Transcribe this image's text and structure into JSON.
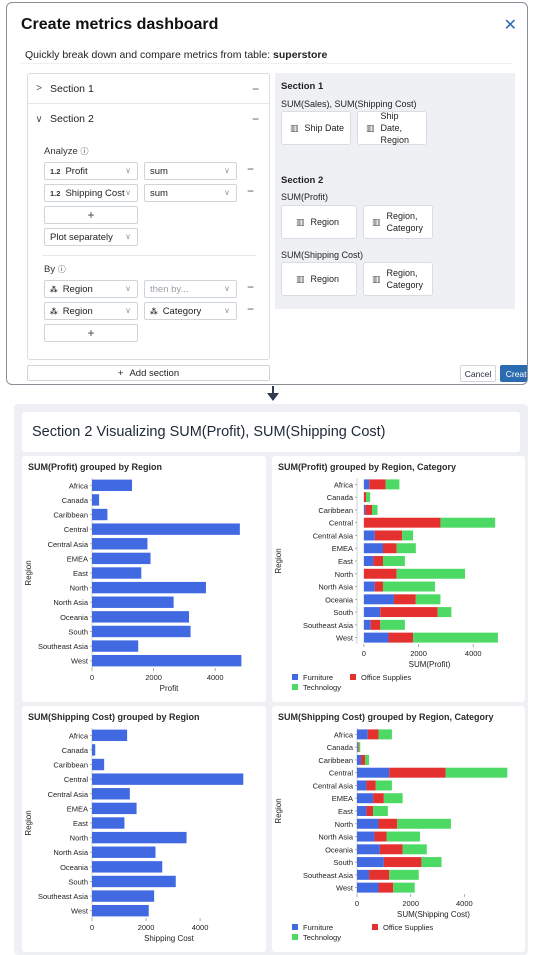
{
  "dialog": {
    "title": "Create metrics dashboard",
    "subtitle_prefix": "Quickly break down and compare metrics from table: ",
    "table_name": "superstore",
    "add_section_label": "Add section",
    "cancel_label": "Cancel",
    "create_label": "Create"
  },
  "editor": {
    "section1": {
      "label": "Section 1"
    },
    "section2": {
      "label": "Section 2",
      "analyze_label": "Analyze",
      "metrics": [
        {
          "type": "1.2",
          "field": "Profit",
          "agg": "sum"
        },
        {
          "type": "1.2",
          "field": "Shipping Cost",
          "agg": "sum"
        }
      ],
      "plot_mode": "Plot separately",
      "by_label": "By",
      "dims": [
        {
          "field": "Region",
          "second_placeholder": "then by..."
        },
        {
          "field": "Region",
          "second": "Category"
        }
      ]
    }
  },
  "preview": {
    "s1": {
      "title": "Section 1",
      "metrics": "SUM(Sales), SUM(Shipping Cost)",
      "chart_a": "Ship Date",
      "chart_b": "Ship Date, Region"
    },
    "s2": {
      "title": "Section 2",
      "m1": "SUM(Profit)",
      "m1_a": "Region",
      "m1_b": "Region, Category",
      "m2": "SUM(Shipping Cost)",
      "m2_a": "Region",
      "m2_b": "Region, Category"
    }
  },
  "dashboard": {
    "title": "Section 2 Visualizing SUM(Profit), SUM(Shipping Cost)",
    "colors": {
      "bar": "#4169e1",
      "furniture": "#4169e1",
      "office": "#e53030",
      "technology": "#4cd964"
    }
  },
  "chart_data": [
    {
      "type": "bar",
      "title": "SUM(Profit) grouped by Region",
      "xlabel": "Profit",
      "ylabel": "Region",
      "categories": [
        "Africa",
        "Canada",
        "Caribbean",
        "Central",
        "Central Asia",
        "EMEA",
        "East",
        "North",
        "North Asia",
        "Oceania",
        "South",
        "Southeast Asia",
        "West"
      ],
      "values": [
        1300,
        230,
        500,
        4800,
        1800,
        1900,
        1600,
        3700,
        2650,
        3150,
        3200,
        1500,
        4850
      ],
      "xticks": [
        0,
        2000,
        4000
      ],
      "xlim": [
        0,
        5000
      ]
    },
    {
      "type": "bar",
      "title": "SUM(Profit) grouped by Region, Category",
      "xlabel": "SUM(Profit)",
      "ylabel": "Region",
      "categories": [
        "Africa",
        "Canada",
        "Caribbean",
        "Central",
        "Central Asia",
        "EMEA",
        "East",
        "North",
        "North Asia",
        "Oceania",
        "South",
        "Southeast Asia",
        "West"
      ],
      "series": [
        {
          "name": "Furniture",
          "values": [
            200,
            0,
            50,
            0,
            400,
            700,
            350,
            0,
            400,
            1100,
            600,
            250,
            900
          ]
        },
        {
          "name": "Office Supplies",
          "values": [
            600,
            80,
            250,
            2800,
            1000,
            500,
            350,
            1200,
            300,
            800,
            2100,
            350,
            900
          ]
        },
        {
          "name": "Technology",
          "values": [
            500,
            150,
            200,
            2000,
            400,
            700,
            800,
            2500,
            1900,
            900,
            500,
            900,
            3100
          ]
        }
      ],
      "xticks": [
        0,
        2000,
        4000
      ],
      "xlim": [
        -250,
        5050
      ],
      "legend": "bottom"
    },
    {
      "type": "bar",
      "title": "SUM(Shipping Cost) grouped by Region",
      "xlabel": "Shipping Cost",
      "ylabel": "Region",
      "categories": [
        "Africa",
        "Canada",
        "Caribbean",
        "Central",
        "Central Asia",
        "EMEA",
        "East",
        "North",
        "North Asia",
        "Oceania",
        "South",
        "Southeast Asia",
        "West"
      ],
      "values": [
        1300,
        120,
        450,
        5600,
        1400,
        1650,
        1200,
        3500,
        2350,
        2600,
        3100,
        2300,
        2100
      ],
      "xticks": [
        0,
        2000,
        4000
      ],
      "xlim": [
        0,
        5700
      ]
    },
    {
      "type": "bar",
      "title": "SUM(Shipping Cost) grouped by Region, Category",
      "xlabel": "SUM(Shipping Cost)",
      "ylabel": "Region",
      "categories": [
        "Africa",
        "Canada",
        "Caribbean",
        "Central",
        "Central Asia",
        "EMEA",
        "East",
        "North",
        "North Asia",
        "Oceania",
        "South",
        "Southeast Asia",
        "West"
      ],
      "series": [
        {
          "name": "Furniture",
          "values": [
            400,
            30,
            150,
            1200,
            350,
            600,
            350,
            800,
            650,
            850,
            1000,
            450,
            800
          ]
        },
        {
          "name": "Office Supplies",
          "values": [
            400,
            30,
            150,
            2100,
            350,
            400,
            250,
            700,
            450,
            850,
            1400,
            750,
            550
          ]
        },
        {
          "name": "Technology",
          "values": [
            500,
            60,
            150,
            2300,
            600,
            700,
            550,
            2000,
            1250,
            900,
            750,
            1100,
            800
          ]
        }
      ],
      "xticks": [
        0,
        2000,
        4000
      ],
      "xlim": [
        0,
        5700
      ],
      "legend": "bottom"
    }
  ]
}
